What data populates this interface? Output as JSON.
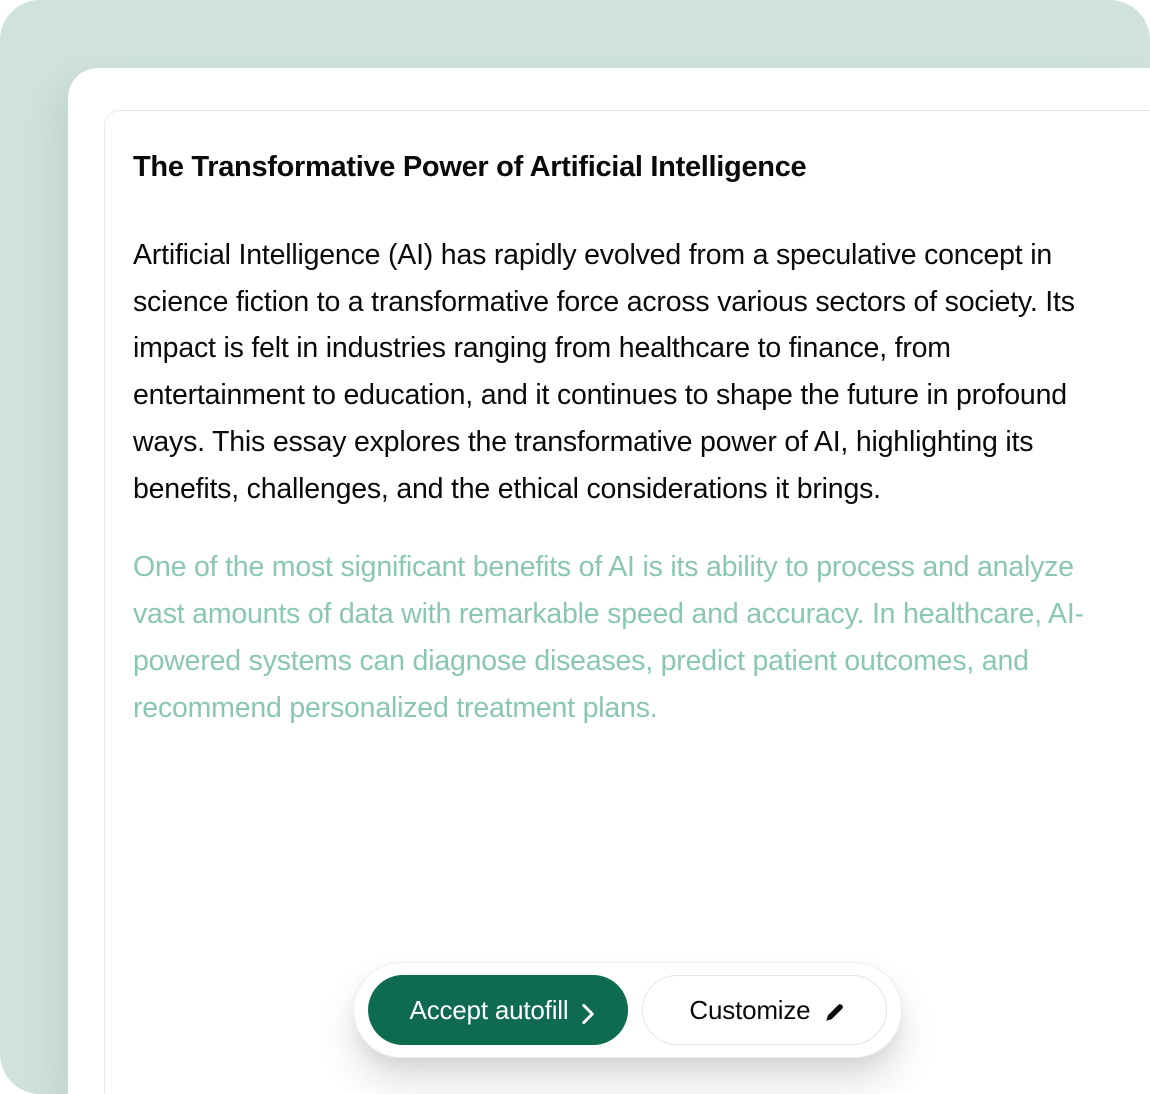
{
  "document": {
    "title": "The Transformative Power of Artificial Intelligence",
    "body_paragraph": "Artificial Intelligence (AI) has rapidly evolved from a speculative concept in science fiction to a transformative force across various sectors of society. Its impact is felt in industries ranging from healthcare to finance, from entertainment to education, and it continues to shape the future in profound ways. This essay explores the transformative power of AI, highlighting its benefits, challenges, and the ethical considerations it brings.",
    "suggested_paragraph": "One of the most significant benefits of AI is its ability to process and analyze vast amounts of data with remarkable speed and accuracy. In healthcare, AI-powered systems can diagnose diseases, predict patient outcomes, and recommend personalized treatment plans."
  },
  "actions": {
    "accept_label": "Accept autofill",
    "customize_label": "Customize"
  },
  "colors": {
    "background_outer": "#cfe2dc",
    "primary_button": "#0e6b4f",
    "suggested_text": "#8ac7b2"
  }
}
